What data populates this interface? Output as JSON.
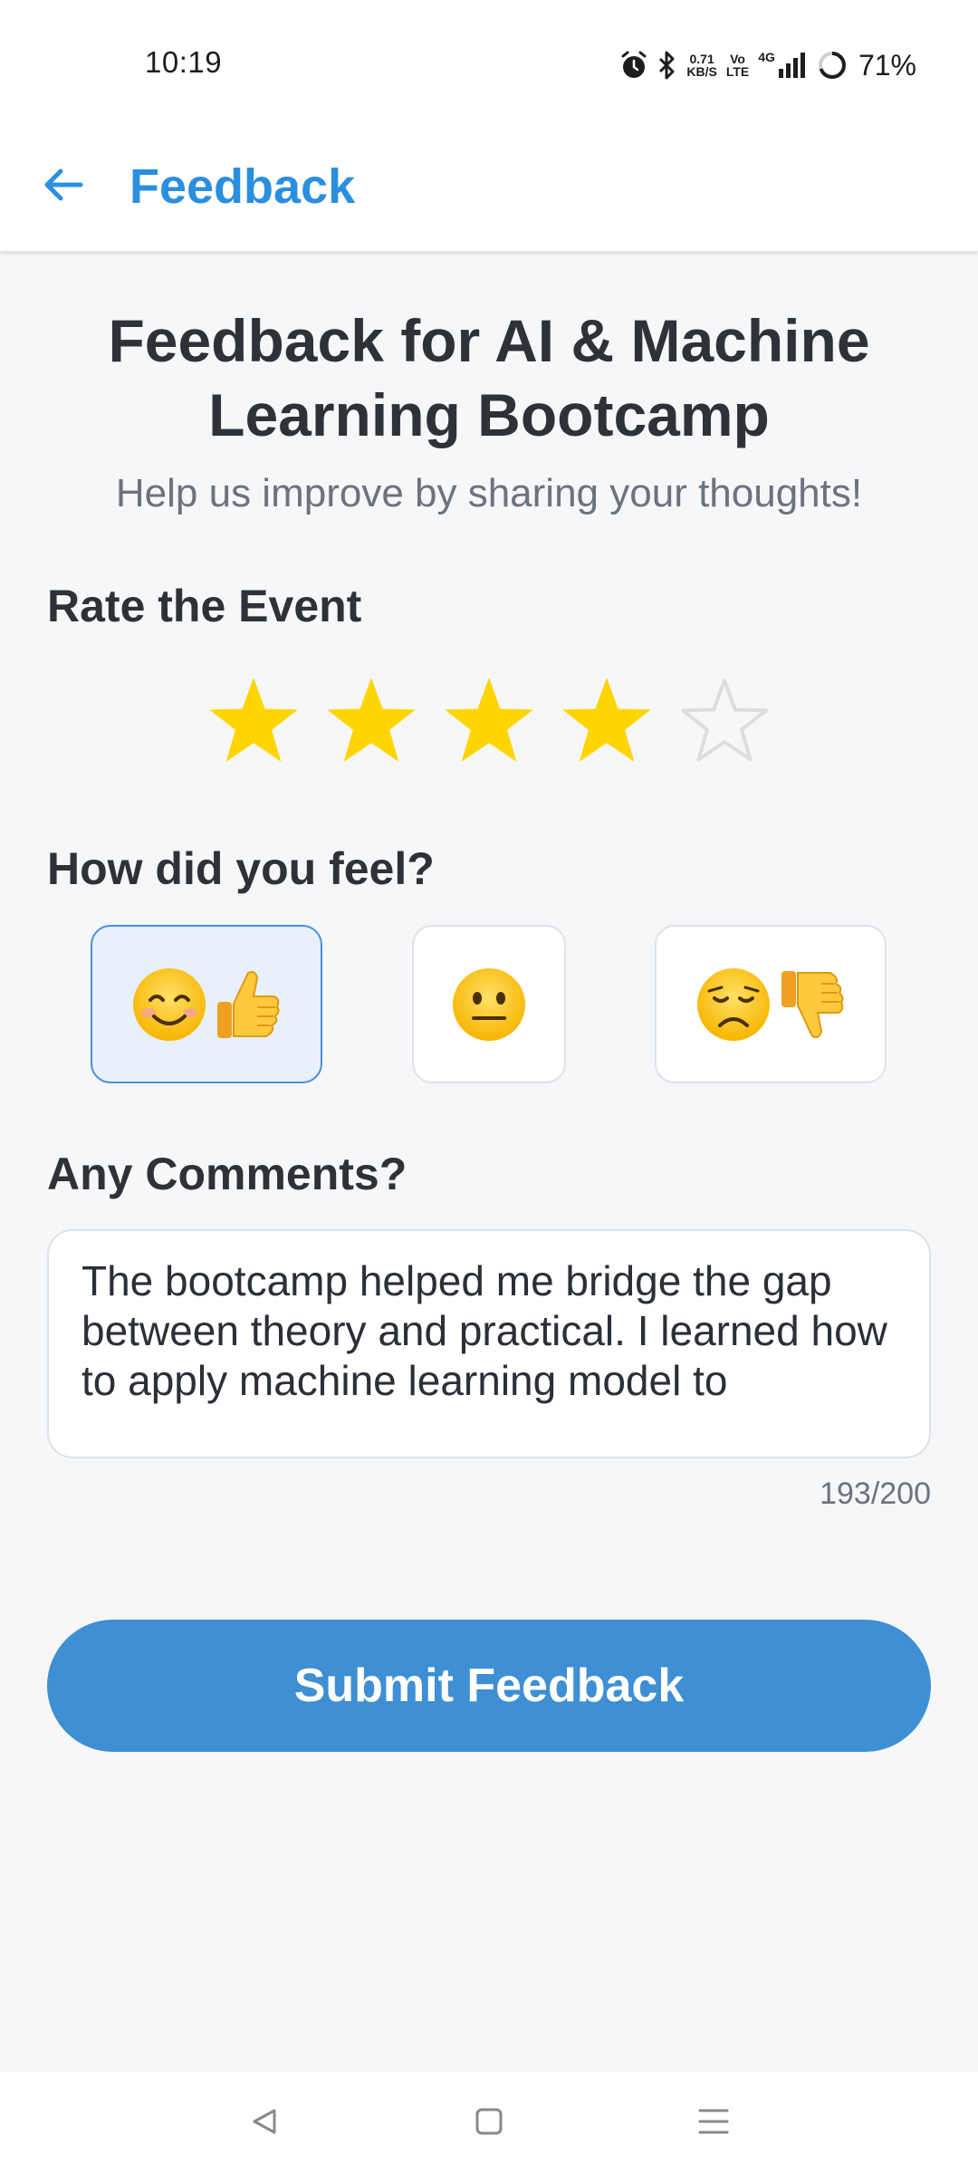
{
  "status_bar": {
    "time": "10:19",
    "net_speed_value": "0.71",
    "net_speed_unit": "KB/S",
    "volte_top": "Vo",
    "volte_bottom": "LTE",
    "network": "4G",
    "battery": "71%",
    "icons": [
      "alarm-icon",
      "bluetooth-icon",
      "signal-icon",
      "battery-ring-icon"
    ]
  },
  "app_bar": {
    "title": "Feedback",
    "back_icon": "arrow-left-icon"
  },
  "header": {
    "title": "Feedback for AI & Machine Learning Bootcamp",
    "subtitle": "Help us improve by sharing your thoughts!"
  },
  "rating": {
    "label": "Rate the Event",
    "value": 4,
    "max": 5,
    "filled_color": "#ffd500",
    "empty_color": "#dddddd"
  },
  "mood": {
    "label": "How did you feel?",
    "options": [
      {
        "name": "positive",
        "emoji": [
          "smiling-face",
          "thumbs-up"
        ],
        "selected": true
      },
      {
        "name": "neutral",
        "emoji": [
          "neutral-face"
        ],
        "selected": false
      },
      {
        "name": "negative",
        "emoji": [
          "disappointed-face",
          "thumbs-down"
        ],
        "selected": false
      }
    ]
  },
  "comments": {
    "label": "Any Comments?",
    "value": "The bootcamp helped me bridge the gap between theory and practical. I learned how to apply machine learning model to",
    "counter": "193/200"
  },
  "submit": {
    "label": "Submit Feedback"
  },
  "colors": {
    "accent": "#2b8fe0",
    "button": "#3e8fd4",
    "selected_bg": "#e7f0fb",
    "selected_border": "#4a8fd9"
  },
  "nav_bar": {
    "icons": [
      "back-triangle-icon",
      "home-square-icon",
      "menu-lines-icon"
    ]
  }
}
